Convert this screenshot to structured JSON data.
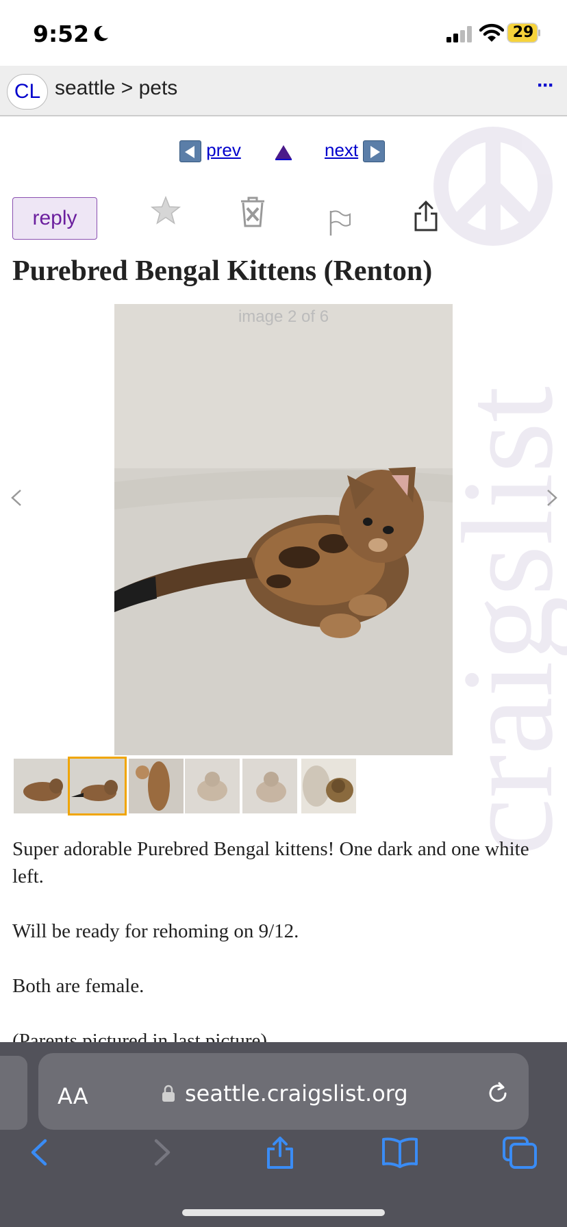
{
  "status_bar": {
    "time": "9:52",
    "battery": "29"
  },
  "header": {
    "logo": "CL",
    "breadcrumb": "seattle > pets",
    "more": "···"
  },
  "watermark": "craigslist",
  "nav": {
    "prev": "prev",
    "next": "next"
  },
  "actions": {
    "reply": "reply"
  },
  "post": {
    "title": "Purebred Bengal Kittens (Renton)",
    "image_counter": "image 2 of 6",
    "thumbnail_count": 6,
    "selected_thumbnail": 2,
    "description": [
      "Super adorable Purebred Bengal kittens! One dark and one white left.",
      "Will be ready for rehoming on 9/12.",
      "Both are female.",
      "(Parents pictured in last picture)"
    ]
  },
  "browser": {
    "text_size_label": "AA",
    "url": "seattle.craigslist.org"
  },
  "colors": {
    "link": "#0000cc",
    "reply_text": "#6b1f9e",
    "thumb_selected": "#f0a500",
    "safari_bar": "#52525a",
    "safari_icon": "#3a8cf5"
  }
}
